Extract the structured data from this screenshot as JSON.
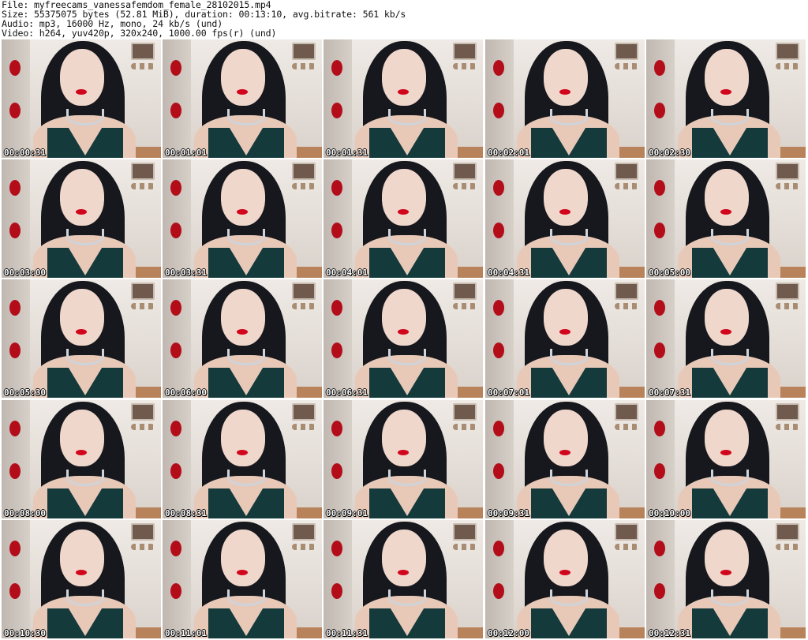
{
  "header": {
    "line1": "File: myfreecams_vanessafemdom_female_28102015.mp4",
    "line2": "Size: 55375075 bytes (52.81 MiB), duration: 00:13:10, avg.bitrate: 561 kb/s",
    "line3": "Audio: mp3, 16000 Hz, mono, 24 kb/s (und)",
    "line4": "Video: h264, yuv420p, 320x240, 1000.00 fps(r) (und)"
  },
  "thumbnails": [
    {
      "timestamp": "00:00:31"
    },
    {
      "timestamp": "00:01:01"
    },
    {
      "timestamp": "00:01:31"
    },
    {
      "timestamp": "00:02:01"
    },
    {
      "timestamp": "00:02:30"
    },
    {
      "timestamp": "00:03:00"
    },
    {
      "timestamp": "00:03:31"
    },
    {
      "timestamp": "00:04:01"
    },
    {
      "timestamp": "00:04:31"
    },
    {
      "timestamp": "00:05:00"
    },
    {
      "timestamp": "00:05:30"
    },
    {
      "timestamp": "00:06:00"
    },
    {
      "timestamp": "00:06:31"
    },
    {
      "timestamp": "00:07:01"
    },
    {
      "timestamp": "00:07:31"
    },
    {
      "timestamp": "00:08:00"
    },
    {
      "timestamp": "00:08:31"
    },
    {
      "timestamp": "00:09:01"
    },
    {
      "timestamp": "00:09:31"
    },
    {
      "timestamp": "00:10:00"
    },
    {
      "timestamp": "00:10:30"
    },
    {
      "timestamp": "00:11:01"
    },
    {
      "timestamp": "00:11:31"
    },
    {
      "timestamp": "00:12:00"
    },
    {
      "timestamp": "00:12:31"
    }
  ]
}
